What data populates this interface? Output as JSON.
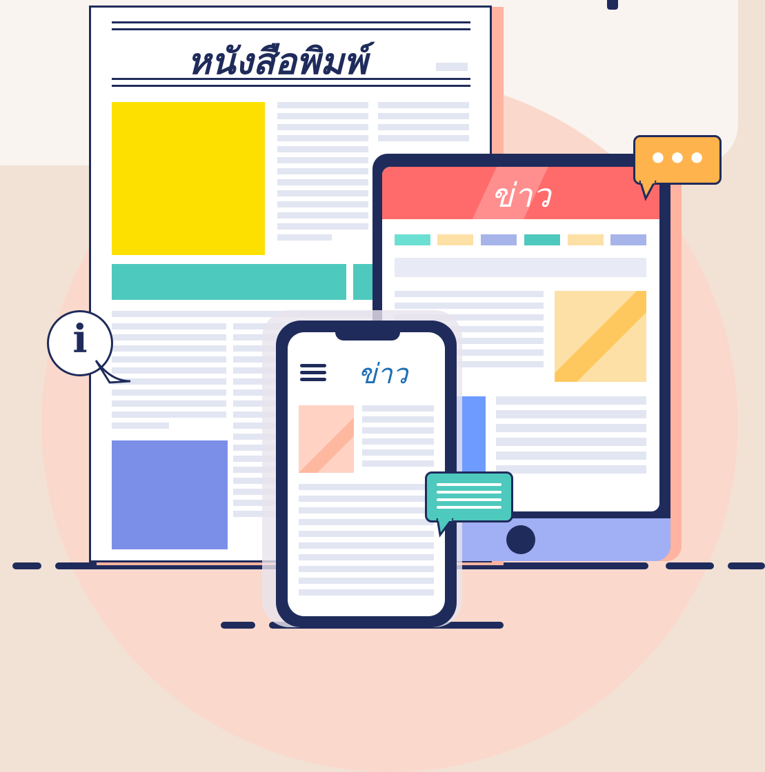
{
  "newspaper": {
    "title": "หนังสือพิมพ์"
  },
  "tablet": {
    "title": "ข่าว"
  },
  "phone": {
    "title": "ข่าว"
  },
  "info_bubble": {
    "glyph": "i"
  },
  "chat_bubble": {
    "glyph": "•••"
  },
  "icons": [
    "menu-icon",
    "info-icon",
    "chat-dots-icon",
    "chat-lines-icon"
  ],
  "colors": {
    "navy": "#1f2b5b",
    "yellow": "#fde000",
    "teal": "#4ec9bd",
    "periwinkle": "#7b8fe8",
    "coral": "#ff6b6b",
    "orange": "#ffb34d",
    "peach": "#fad9cc"
  }
}
